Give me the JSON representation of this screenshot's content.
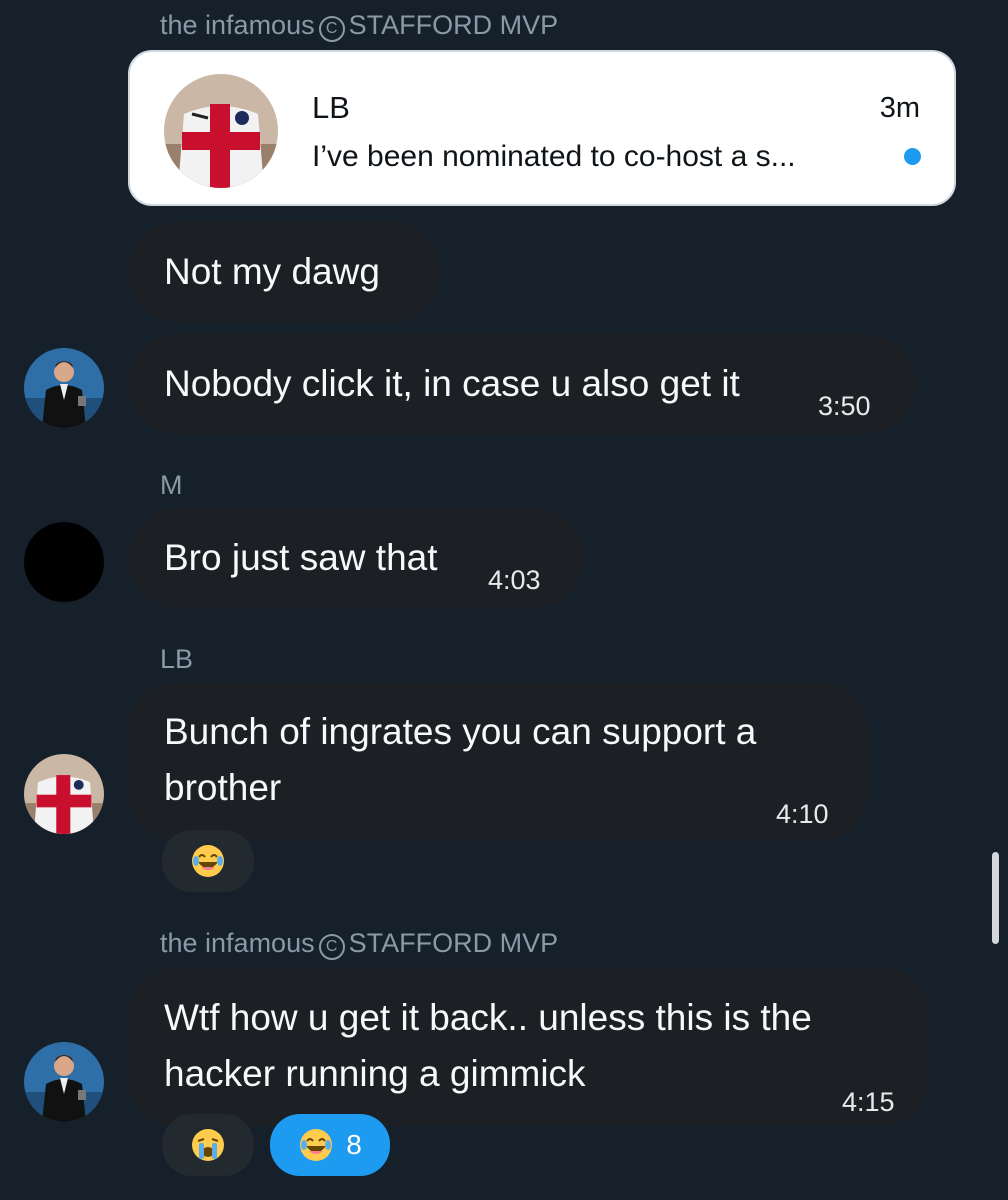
{
  "colors": {
    "background": "#15202b",
    "bubble": "#1c1f23",
    "accent": "#1d9bf0",
    "muted": "#8b98a5"
  },
  "shared_card": {
    "name": "LB",
    "time": "3m",
    "preview": "I’ve been nominated to co-host a s...",
    "avatar_icon": "soccer-jersey-avatar"
  },
  "messages": [
    {
      "sender_before": "the infamous",
      "sender_after": "STAFFORD MVP",
      "text": "Not my dawg",
      "time": ""
    },
    {
      "text": "Nobody click it, in case u also get it",
      "time": "3:50",
      "avatar_icon": "man-in-suit-avatar"
    },
    {
      "sender": "M",
      "text": "Bro just saw that",
      "time": "4:03",
      "avatar_icon": "black-circle-avatar"
    },
    {
      "sender": "LB",
      "text_line1": "Bunch of ingrates you can support a",
      "text_line2": "brother",
      "time": "4:10",
      "avatar_icon": "soccer-jersey-avatar",
      "reactions": [
        {
          "icon": "laughing-tears-emoji",
          "count": ""
        }
      ]
    },
    {
      "sender_before": "the infamous",
      "sender_after": "STAFFORD MVP",
      "text_line1": "Wtf how u get it back.. unless this is the",
      "text_line2": "hacker running a gimmick",
      "time": "4:15",
      "avatar_icon": "man-in-suit-avatar",
      "reactions": [
        {
          "icon": "crying-emoji",
          "count": ""
        },
        {
          "icon": "laughing-tears-emoji",
          "count": "8"
        }
      ]
    }
  ]
}
